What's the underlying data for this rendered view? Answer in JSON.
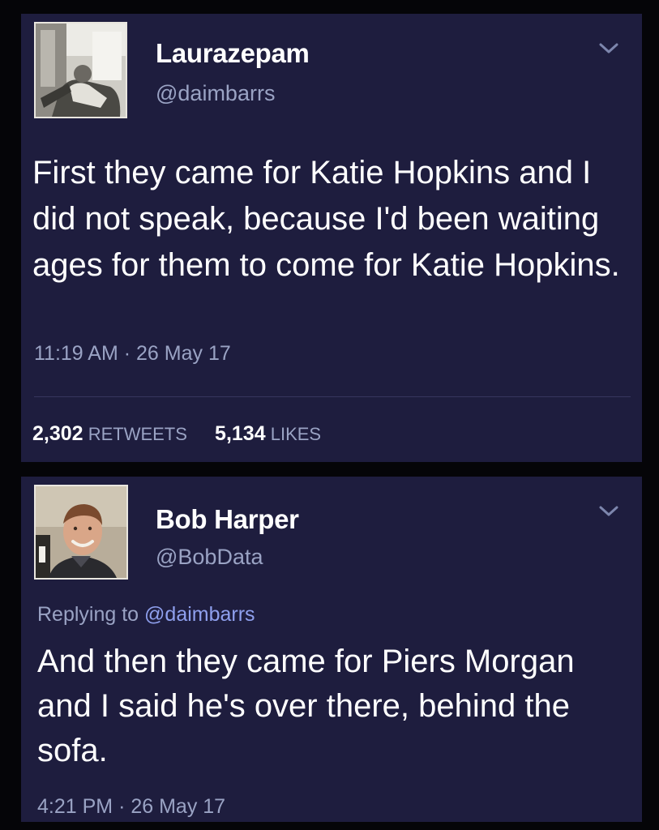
{
  "tweets": [
    {
      "display_name": "Laurazepam",
      "handle": "@daimbarrs",
      "text": "First they came for Katie Hopkins and I did not speak, because I'd been waiting ages for them to come for Katie Hopkins.",
      "time": "11:19 AM",
      "date": "26 May 17",
      "retweets": "2,302",
      "retweets_label": "RETWEETS",
      "likes": "5,134",
      "likes_label": "LIKES",
      "avatar_icon": "user-photo-icon"
    },
    {
      "display_name": "Bob Harper",
      "handle": "@BobData",
      "replying_prefix": "Replying to",
      "replying_to": "@daimbarrs",
      "text": "And then they came for Piers Morgan and I said he's over there, behind the sofa.",
      "time": "4:21 PM",
      "date": "26 May 17",
      "avatar_icon": "user-photo-icon"
    }
  ],
  "colors": {
    "background": "#050508",
    "card": "#1e1d3e",
    "text": "#ffffff",
    "muted": "#9aa3c4",
    "link": "#8fa0ee"
  },
  "icons": {
    "menu": "chevron-down-icon"
  },
  "separator": "·"
}
